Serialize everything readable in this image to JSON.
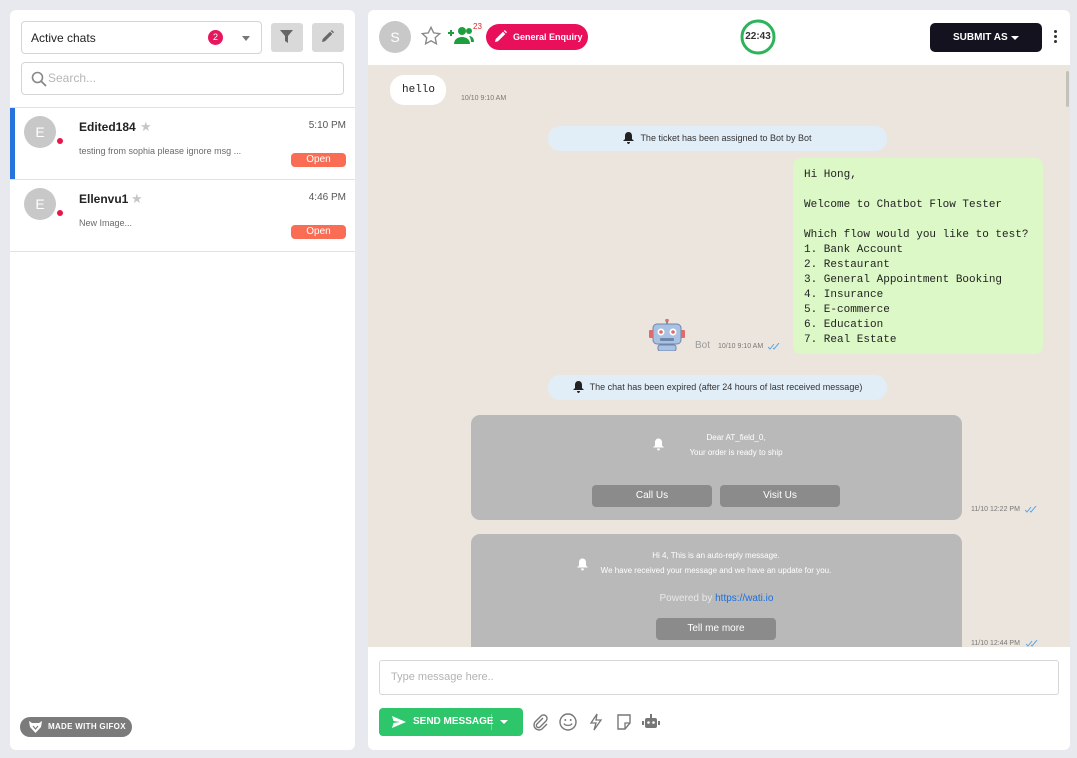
{
  "sidebar": {
    "filter_select": {
      "label": "Active chats",
      "count": "2"
    },
    "search": {
      "placeholder": "Search..."
    },
    "chats": [
      {
        "avatar": "E",
        "name": "Edited184",
        "time": "5:10 PM",
        "preview": "testing from sophia please ignore msg ...",
        "status": "Open",
        "active": true
      },
      {
        "avatar": "E",
        "name": "Ellenvu1",
        "time": "4:46 PM",
        "preview": "New Image...",
        "status": "Open",
        "active": false
      }
    ],
    "watermark": "MADE WITH GIFOX"
  },
  "header": {
    "avatar": "S",
    "team_count": "23",
    "topic_tag": "General Enquiry",
    "timer": "22:43",
    "submit_label": "SUBMIT AS"
  },
  "messages": {
    "m1": {
      "text": "hello",
      "time": "10/10 9:10 AM"
    },
    "sys1": "The ticket has been assigned to Bot by Bot",
    "bot_msg": {
      "text": "Hi Hong,\n\nWelcome to Chatbot Flow Tester\n\nWhich flow would you like to test?\n1. Bank Account\n2. Restaurant\n3. General Appointment Booking\n4. Insurance\n5. E-commerce\n6. Education\n7. Real Estate",
      "sender": "Bot",
      "time": "10/10 9:10 AM"
    },
    "sys2": "The chat has been expired (after 24 hours of last received message)",
    "tpl1": {
      "line1": "Dear AT_field_0,",
      "line2": "Your order is ready to ship",
      "btn1": "Call Us",
      "btn2": "Visit Us",
      "time": "11/10 12:22 PM"
    },
    "tpl2": {
      "line1": "Hi 4, This is an auto-reply message.",
      "line2": "We have received your message and we have an update for you.",
      "powered_by": "Powered by",
      "link": "https://wati.io",
      "btn": "Tell me more",
      "time": "11/10 12:44 PM"
    }
  },
  "composer": {
    "placeholder": "Type message here..",
    "send_label": "SEND MESSAGE"
  },
  "icons": [
    "search-icon",
    "filter-icon",
    "edit-icon",
    "star-icon",
    "team-icon",
    "pencil-icon",
    "bell-icon",
    "robot-icon",
    "double-check-icon",
    "send-icon",
    "attachment-icon",
    "emoji-icon",
    "quick-reply-icon",
    "sticker-icon",
    "bot-icon",
    "kebab-icon",
    "gifox-logo-icon"
  ],
  "colors": {
    "accent_blue": "#2673dd",
    "open_pill": "#fa6d55",
    "tag_pink": "#ea0f5b",
    "send_green": "#2ec66a",
    "out_bubble": "#dcf8c6",
    "timer_green": "#2db35b"
  }
}
